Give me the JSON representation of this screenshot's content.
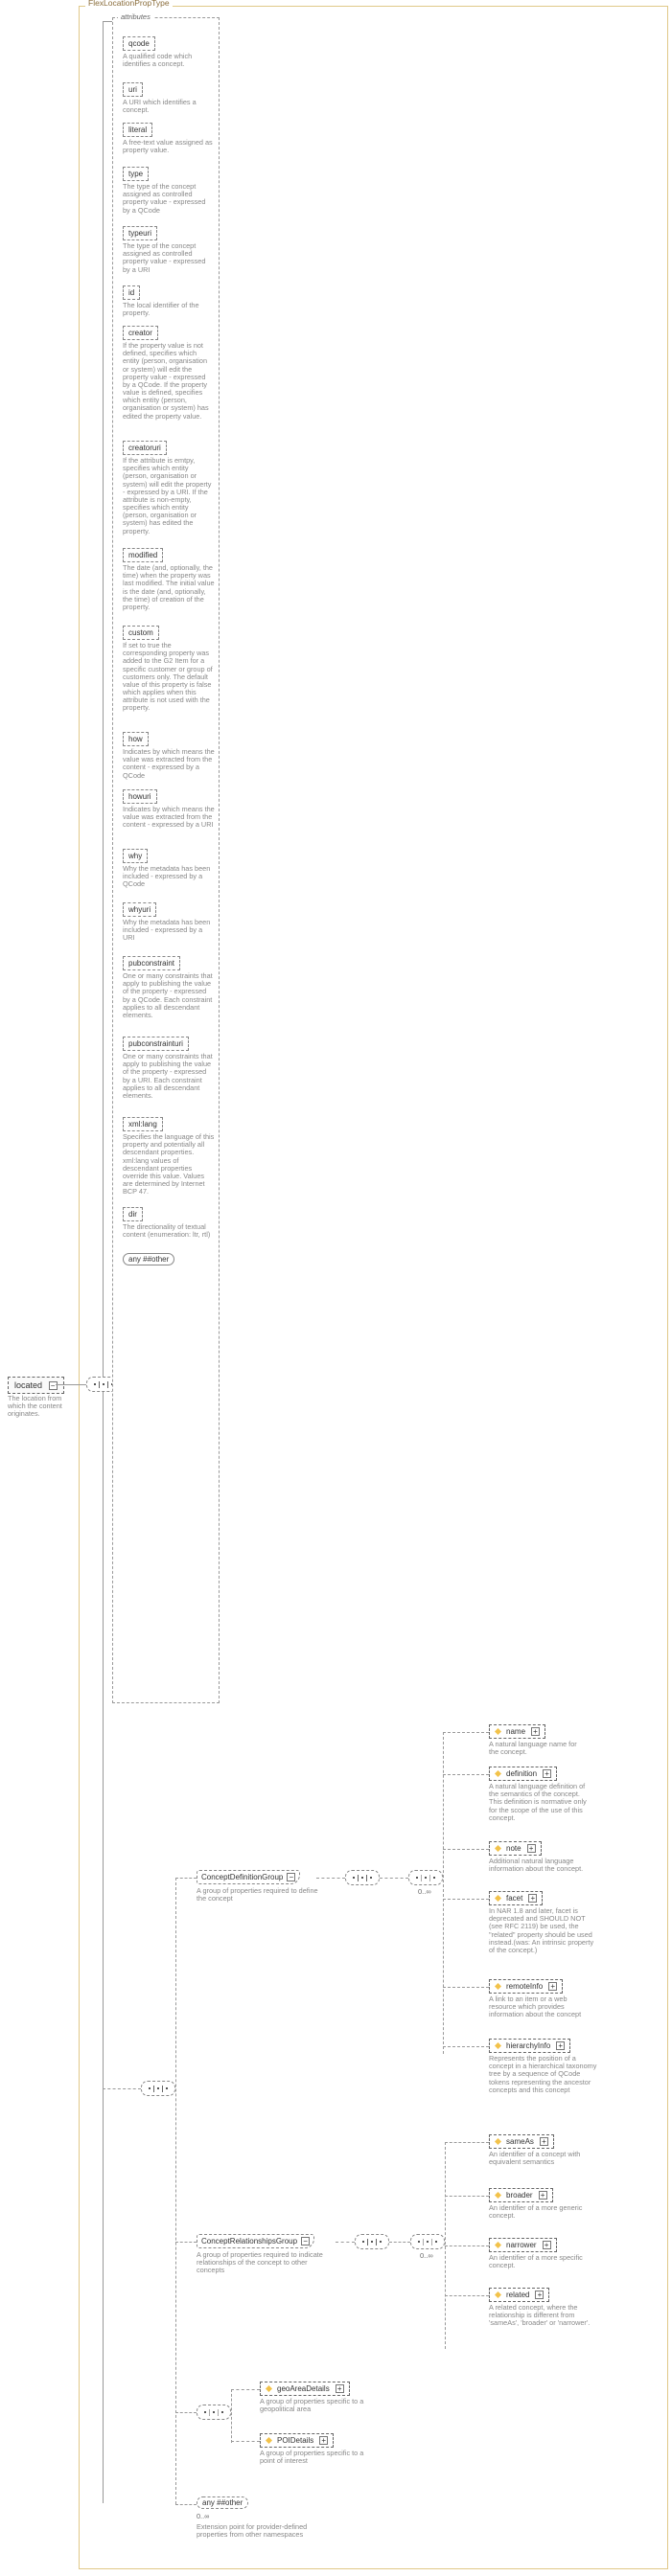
{
  "type_name": "FlexLocationPropType",
  "root_element": {
    "name": "located",
    "doc": "The location from which the content originates."
  },
  "attr_group_label": "attributes",
  "attributes": [
    {
      "name": "qcode",
      "doc": "A qualified code which identifies a concept."
    },
    {
      "name": "uri",
      "doc": "A URI which identifies a concept."
    },
    {
      "name": "literal",
      "doc": "A free-text value assigned as property value."
    },
    {
      "name": "type",
      "doc": "The type of the concept assigned as controlled property value - expressed by a QCode"
    },
    {
      "name": "typeuri",
      "doc": "The type of the concept assigned as controlled property value - expressed by a URI"
    },
    {
      "name": "id",
      "doc": "The local identifier of the property."
    },
    {
      "name": "creator",
      "doc": "If the property value is not defined, specifies which entity (person, organisation or system) will edit the property value - expressed by a QCode. If the property value is defined, specifies which entity (person, organisation or system) has edited the property value."
    },
    {
      "name": "creatoruri",
      "doc": "If the attribute is emtpy, specifies which entity (person, organisation or system) will edit the property - expressed by a URI. If the attribute is non-empty, specifies which entity (person, organisation or system) has edited the property."
    },
    {
      "name": "modified",
      "doc": "The date (and, optionally, the time) when the property was last modified. The initial value is the date (and, optionally, the time) of creation of the property."
    },
    {
      "name": "custom",
      "doc": "If set to true the corresponding property was added to the G2 Item for a specific customer or group of customers only. The default value of this property is false which applies when this attribute is not used with the property."
    },
    {
      "name": "how",
      "doc": "Indicates by which means the value was extracted from the content - expressed by a QCode"
    },
    {
      "name": "howuri",
      "doc": "Indicates by which means the value was extracted from the content - expressed by a URI"
    },
    {
      "name": "why",
      "doc": "Why the metadata has been included - expressed by a QCode"
    },
    {
      "name": "whyuri",
      "doc": "Why the metadata has been included - expressed by a URI"
    },
    {
      "name": "pubconstraint",
      "doc": "One or many constraints that apply to publishing the value of the property - expressed by a QCode. Each constraint applies to all descendant elements."
    },
    {
      "name": "pubconstrainturi",
      "doc": "One or many constraints that apply to publishing the value of the property - expressed by a URI. Each constraint applies to all descendant elements."
    },
    {
      "name": "xml:lang",
      "doc": "Specifies the language of this property and potentially all descendant properties. xml:lang values of descendant properties override this value. Values are determined by Internet BCP 47."
    },
    {
      "name": "dir",
      "doc": "The directionality of textual content (enumeration: ltr, rtl)"
    }
  ],
  "attr_wildcard": "any ##other",
  "groups": {
    "definition": {
      "name": "ConceptDefinitionGroup",
      "doc": "A group of properties required to define the concept",
      "occur": "0..∞",
      "children": [
        {
          "name": "name",
          "doc": "A natural language name for the concept."
        },
        {
          "name": "definition",
          "doc": "A natural language definition of the semantics of the concept. This definition is normative only for the scope of the use of this concept."
        },
        {
          "name": "note",
          "doc": "Additional natural language information about the concept."
        },
        {
          "name": "facet",
          "doc": "In NAR 1.8 and later, facet is deprecated and SHOULD NOT (see RFC 2119) be used, the \"related\" property should be used instead.(was: An intrinsic property of the concept.)"
        },
        {
          "name": "remoteInfo",
          "doc": "A link to an item or a web resource which provides information about the concept"
        },
        {
          "name": "hierarchyInfo",
          "doc": "Represents the position of a concept in a hierarchical taxonomy tree by a sequence of QCode tokens representing the ancestor concepts and this concept"
        }
      ]
    },
    "relationships": {
      "name": "ConceptRelationshipsGroup",
      "doc": "A group of properties required to indicate relationships of the concept to other concepts",
      "occur": "0..∞",
      "children": [
        {
          "name": "sameAs",
          "doc": "An identifier of a concept with equivalent semantics"
        },
        {
          "name": "broader",
          "doc": "An identifier of a more generic concept."
        },
        {
          "name": "narrower",
          "doc": "An identifier of a more specific concept."
        },
        {
          "name": "related",
          "doc": "A related concept, where the relationship is different from 'sameAs', 'broader' or 'narrower'."
        }
      ]
    }
  },
  "choice_children": [
    {
      "name": "geoAreaDetails",
      "doc": "A group of properties specific to a geopolitical area"
    },
    {
      "name": "POIDetails",
      "doc": "A group of properties specific to a point of interest"
    }
  ],
  "elem_wildcard": {
    "label": "any ##other",
    "occur": "0..∞",
    "doc": "Extension point for provider-defined properties from other namespaces"
  }
}
